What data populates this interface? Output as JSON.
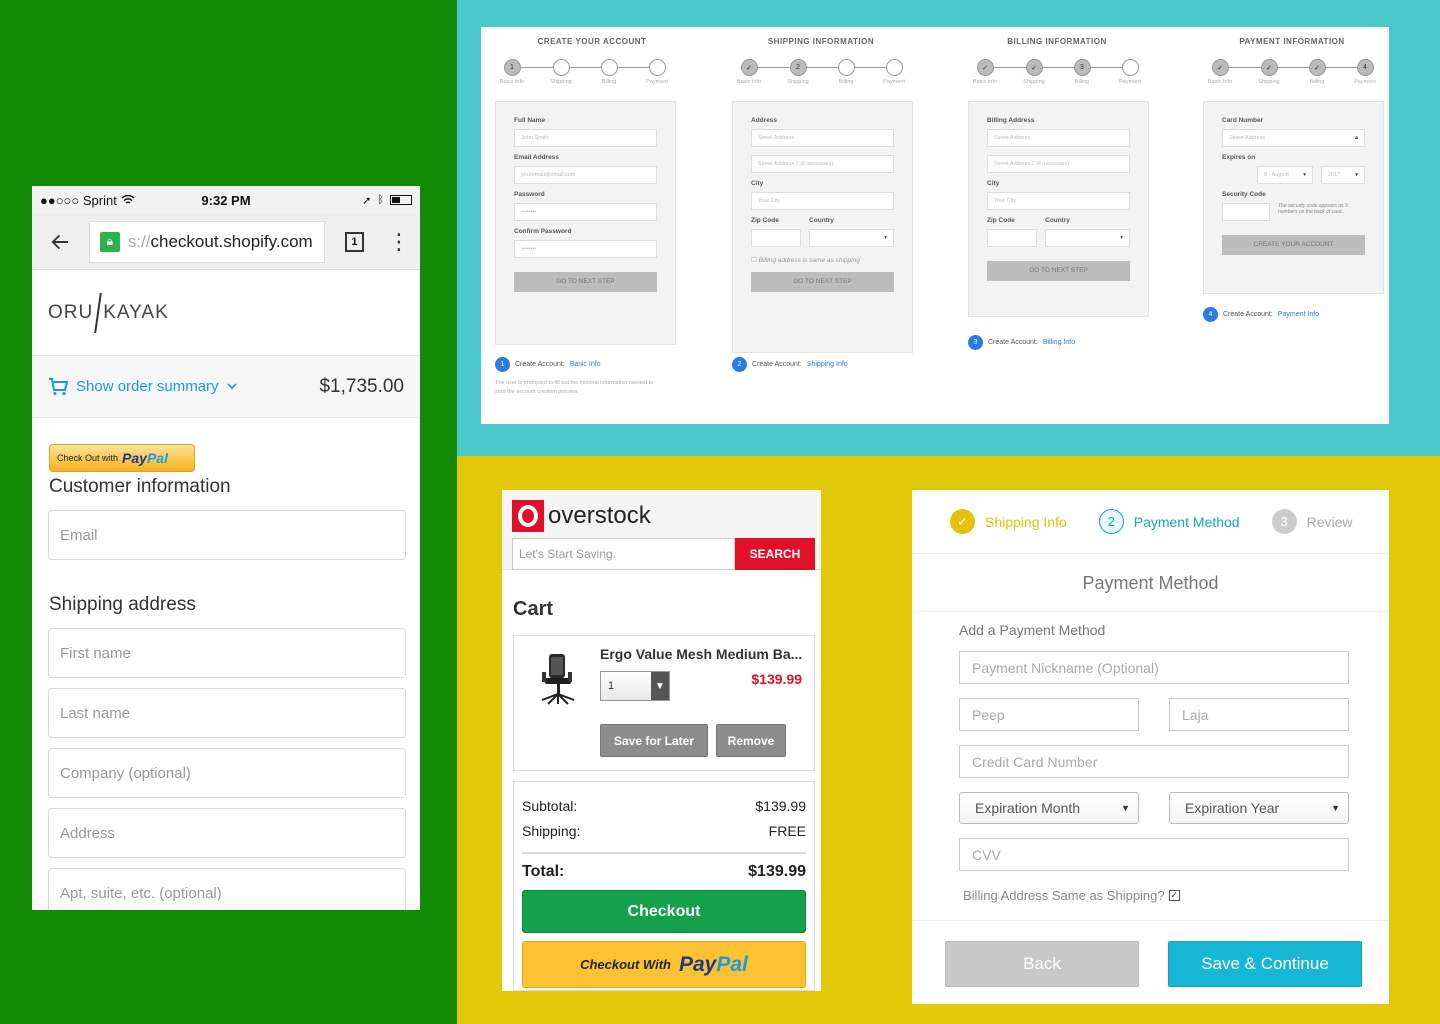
{
  "colors": {
    "green_bg": "#138a04",
    "teal_bg": "#4bc9ca",
    "yellow_bg": "#e3c80a",
    "overstock_red": "#e0102b",
    "shopify_link": "#1c9ae0",
    "teal_accent": "#17b6d6"
  },
  "shopify_mobile": {
    "status": {
      "carrier": "●●○○○ Sprint",
      "time": "9:32 PM"
    },
    "url": {
      "dim": "s://",
      "host": "checkout.shopify.com"
    },
    "tab_count": "1",
    "brand": {
      "left": "ORU",
      "right": "KAYAK"
    },
    "order_summary_label": "Show order summary",
    "order_total": "$1,735.00",
    "paypal_button": {
      "prefix": "Check Out with",
      "pay": "Pay",
      "pal": "Pal"
    },
    "customer_info_title": "Customer information",
    "email_placeholder": "Email",
    "shipping_title": "Shipping address",
    "fields": [
      "First name",
      "Last name",
      "Company (optional)",
      "Address",
      "Apt, suite, etc. (optional)"
    ]
  },
  "wireframe": {
    "columns": [
      {
        "title": "CREATE YOUR ACCOUNT",
        "steps": [
          "1",
          "",
          "",
          ""
        ],
        "step_labels": [
          "Basic Info",
          "Shipping",
          "Billing",
          "Payment"
        ],
        "fields": [
          {
            "label": "Full Name",
            "placeholder": "John Smith"
          },
          {
            "label": "Email Address",
            "placeholder": "youremail@email.com"
          },
          {
            "label": "Password",
            "placeholder": "••••••••"
          },
          {
            "label": "Confirm Password",
            "placeholder": "••••••••"
          }
        ],
        "button": "GO TO NEXT STEP",
        "caption_num": "1",
        "caption_prefix": "Create Account:",
        "caption_link": "Basic Info",
        "note": "The user is prompted to fill out the minimal information needed to start the account creation process"
      },
      {
        "title": "SHIPPING INFORMATION",
        "steps": [
          "✓",
          "2",
          "",
          ""
        ],
        "step_labels": [
          "Basic Info",
          "Shipping",
          "Billing",
          "Payment"
        ],
        "fields": [
          {
            "label": "Address",
            "placeholder": "Street Address"
          },
          {
            "label": "",
            "placeholder": "Street Address 2 (if necessary)"
          },
          {
            "label": "City",
            "placeholder": "Your City"
          }
        ],
        "split_labels": [
          "Zip Code",
          "Country"
        ],
        "check_note": "Billing address is same as shipping",
        "button": "GO TO NEXT STEP",
        "caption_num": "2",
        "caption_prefix": "Create Account:",
        "caption_link": "Shipping Info"
      },
      {
        "title": "BILLING INFORMATION",
        "steps": [
          "✓",
          "✓",
          "3",
          ""
        ],
        "step_labels": [
          "Basic Info",
          "Shipping",
          "Billing",
          "Payment"
        ],
        "fields": [
          {
            "label": "Billing Address",
            "placeholder": "Street Address"
          },
          {
            "label": "",
            "placeholder": "Street Address 2 (if necessary)"
          },
          {
            "label": "City",
            "placeholder": "Your City"
          }
        ],
        "split_labels": [
          "Zip Code",
          "Country"
        ],
        "button": "GO TO NEXT STEP",
        "caption_num": "3",
        "caption_prefix": "Create Account:",
        "caption_link": "Billing Info"
      },
      {
        "title": "PAYMENT INFORMATION",
        "steps": [
          "✓",
          "✓",
          "✓",
          "4"
        ],
        "step_labels": [
          "Basic Info",
          "Shipping",
          "Billing",
          "Payment"
        ],
        "fields": [
          {
            "label": "Card Number",
            "placeholder": "Street Address"
          }
        ],
        "expires_label": "Expires on",
        "expires_values": [
          "8 - August",
          "2017"
        ],
        "security_label": "Security Code",
        "security_note": "The security code appears as 3 numbers on the back of card.",
        "button": "CREATE YOUR ACCOUNT",
        "caption_num": "4",
        "caption_prefix": "Create Account:",
        "caption_link": "Payment Info"
      }
    ]
  },
  "overstock": {
    "brand": "overstock",
    "search_placeholder": "Let's Start Saving.",
    "search_button": "SEARCH",
    "cart_title": "Cart",
    "item": {
      "name": "Ergo Value Mesh Medium Ba...",
      "price": "$139.99",
      "qty": "1",
      "save_label": "Save for Later",
      "remove_label": "Remove"
    },
    "subtotal_label": "Subtotal:",
    "subtotal": "$139.99",
    "shipping_label": "Shipping:",
    "shipping": "FREE",
    "total_label": "Total:",
    "total": "$139.99",
    "checkout_label": "Checkout",
    "paypal_prefix": "Checkout With",
    "paypal_pay": "Pay",
    "paypal_pal": "Pal"
  },
  "payment": {
    "steps": [
      {
        "icon": "✓",
        "label": "Shipping Info",
        "state": "done"
      },
      {
        "icon": "2",
        "label": "Payment Method",
        "state": "active"
      },
      {
        "icon": "3",
        "label": "Review",
        "state": "todo"
      }
    ],
    "title": "Payment Method",
    "add_label": "Add a Payment Method",
    "nickname_placeholder": "Payment Nickname (Optional)",
    "first_name": "Peep",
    "last_name": "Laja",
    "card_placeholder": "Credit Card Number",
    "exp_month": "Expiration Month",
    "exp_year": "Expiration Year",
    "cvv_placeholder": "CVV",
    "billing_same": "Billing Address Same as Shipping?",
    "back_label": "Back",
    "save_label": "Save & Continue"
  }
}
